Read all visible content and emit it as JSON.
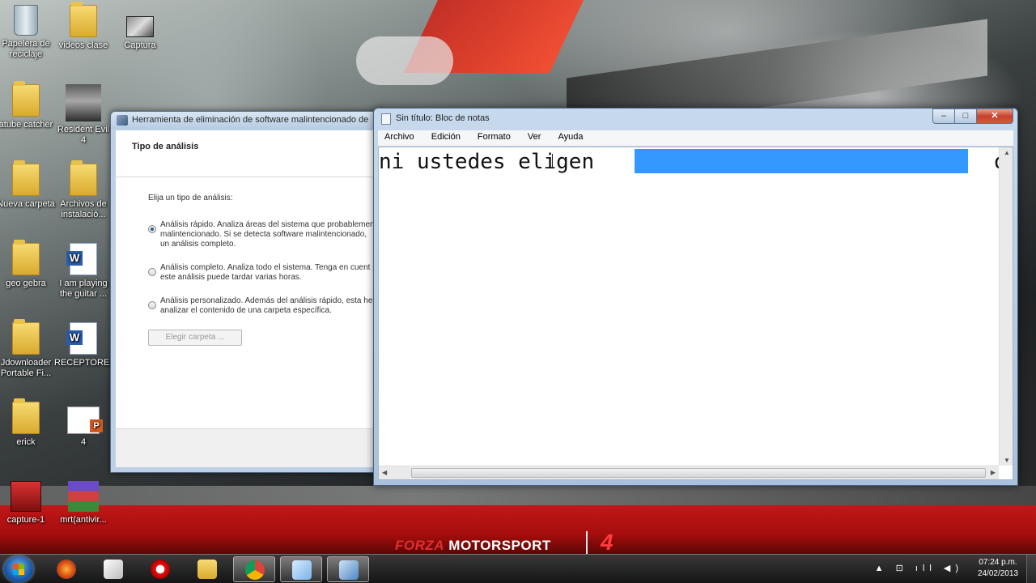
{
  "desktop": {
    "icons": [
      {
        "label": "Papelera de reciclaje",
        "icon": "recycle-bin-icon"
      },
      {
        "label": "videos clase",
        "icon": "folder-icon"
      },
      {
        "label": "Captura",
        "icon": "screenshot-image-icon"
      },
      {
        "label": "atube catcher",
        "icon": "folder-icon"
      },
      {
        "label": "Resident Evil 4",
        "icon": "game-shortcut-icon"
      },
      {
        "label": "Nueva carpeta",
        "icon": "folder-icon"
      },
      {
        "label": "Archivos de instalació...",
        "icon": "folder-shortcut-icon"
      },
      {
        "label": "geo gebra",
        "icon": "folder-icon"
      },
      {
        "label": "I am playing the guitar ...",
        "icon": "word-document-icon"
      },
      {
        "label": "Jdownloader Portable Fi...",
        "icon": "folder-icon"
      },
      {
        "label": "RECEPTORES",
        "icon": "word-document-icon"
      },
      {
        "label": "erick",
        "icon": "folder-icon"
      },
      {
        "label": "4",
        "icon": "powerpoint-document-icon"
      },
      {
        "label": "capture-1",
        "icon": "red-app-icon"
      },
      {
        "label": "mrt(antivir...",
        "icon": "winrar-archive-icon"
      }
    ]
  },
  "wallpaper": {
    "brand_left": "FORZA",
    "brand_right": "MOTORSPORT",
    "brand_mark": "4"
  },
  "mrt": {
    "title": "Herramienta de eliminación de software malintencionado de",
    "header": "Tipo de análisis",
    "prompt": "Elija un tipo de análisis:",
    "options": [
      {
        "line1": "Análisis rápido. Analiza áreas del sistema que probablemen",
        "line2": "malintencionado. Si se detecta software malintencionado,",
        "line3": "un análisis completo.",
        "checked": true
      },
      {
        "line1": "Análisis completo. Analiza todo el sistema. Tenga en cuent",
        "line2": "este análisis puede tardar varias horas.",
        "line3": "",
        "checked": false
      },
      {
        "line1": "Análisis personalizado. Además del análisis rápido, esta her",
        "line2": "analizar el contenido de una carpeta específica.",
        "line3": "",
        "checked": false
      }
    ],
    "choose_folder_label": "Elegir carpeta ..."
  },
  "notepad": {
    "title": "Sin título: Bloc de notas",
    "menu": [
      "Archivo",
      "Edición",
      "Formato",
      "Ver",
      "Ayuda"
    ],
    "text_before": "ni ustedes eligen ",
    "text_after": "o",
    "window_buttons": {
      "minimize": "‒",
      "maximize": "□",
      "close": "✕"
    }
  },
  "taskbar": {
    "pinned": [
      {
        "name": "firefox-icon",
        "active": false
      },
      {
        "name": "adobe-icon",
        "active": false
      },
      {
        "name": "opera-icon",
        "active": false
      },
      {
        "name": "explorer-icon",
        "active": false
      },
      {
        "name": "chrome-icon",
        "active": true
      },
      {
        "name": "notepad-icon",
        "active": true
      },
      {
        "name": "mrt-icon",
        "active": true
      }
    ],
    "tray_icons": "▲ ⊡ ıll ◀)",
    "time": "07:24 p.m.",
    "date": "24/02/2013"
  },
  "colors": {
    "selection": "#3399ff",
    "taskbar_red_band": "#c11818"
  }
}
